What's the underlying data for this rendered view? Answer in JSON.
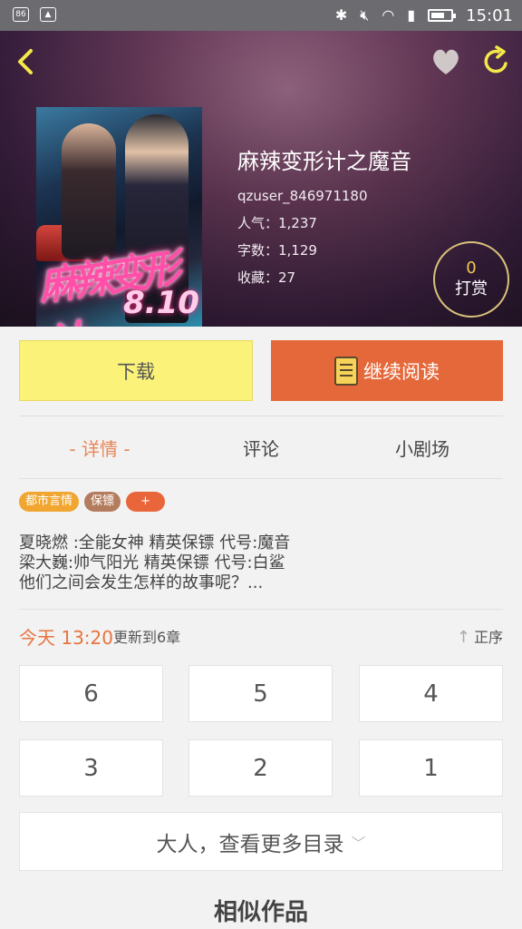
{
  "status_bar": {
    "time": "15:01",
    "icons": [
      "notification-icon",
      "image-icon",
      "bluetooth-icon",
      "mute-icon",
      "wifi-icon",
      "signal-icon",
      "battery-icon"
    ]
  },
  "header": {
    "back_icon": "chevron-left-icon",
    "favorite_icon": "heart-icon",
    "share_icon": "refresh-share-icon"
  },
  "book": {
    "cover_title_art": "麻辣变形计",
    "cover_date_art": "8.10",
    "title": "麻辣变形计之魔音",
    "author": "qzuser_846971180",
    "popularity": "人气：1,237",
    "word_count": "字数：1,129",
    "favorites": "收藏：27"
  },
  "reward": {
    "count": "0",
    "label": "打赏"
  },
  "actions": {
    "download": "下载",
    "continue_reading": "继续阅读"
  },
  "tabs": [
    {
      "label": "- 详情 -",
      "active": true
    },
    {
      "label": "评论",
      "active": false
    },
    {
      "label": "小剧场",
      "active": false
    }
  ],
  "tags": [
    "都市言情",
    "保镖",
    "+"
  ],
  "description": [
    "夏晓燃 :全能女神 精英保镖 代号:魔音",
    "梁大巍:帅气阳光  精英保镖 代号:白鲨",
    "他们之间会发生怎样的故事呢？..."
  ],
  "update": {
    "time": "今天 13:20",
    "text": "更新到6章",
    "sort_label": "正序"
  },
  "chapters": [
    "6",
    "5",
    "4",
    "3",
    "2",
    "1"
  ],
  "more_catalog": "大人，查看更多目录",
  "similar_title": "相似作品",
  "colors": {
    "accent_orange": "#e5683a",
    "download_yellow": "#fbf27a",
    "reward_gold": "#f2c94c"
  }
}
